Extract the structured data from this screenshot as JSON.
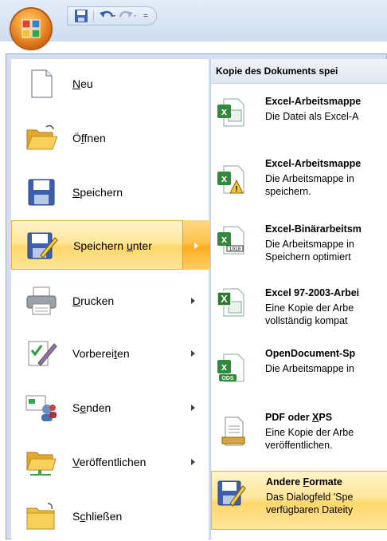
{
  "qat": {
    "save_icon": "save-icon",
    "undo_icon": "undo-icon",
    "redo_icon": "redo-icon",
    "customize_glyph": "="
  },
  "left_menu": [
    {
      "label": "Neu",
      "icon": "new-document-icon",
      "submenu": false,
      "accel": "N"
    },
    {
      "label": "Öffnen",
      "icon": "open-folder-icon",
      "submenu": false,
      "accel": "f"
    },
    {
      "label": "Speichern",
      "icon": "save-icon",
      "submenu": false,
      "accel": "S"
    },
    {
      "label": "Speichern unter",
      "icon": "save-as-icon",
      "submenu": true,
      "selected": true,
      "accel": "u"
    },
    {
      "label": "Drucken",
      "icon": "printer-icon",
      "submenu": true,
      "accel": "D"
    },
    {
      "label": "Vorbereiten",
      "icon": "prepare-icon",
      "submenu": true,
      "accel": "t"
    },
    {
      "label": "Senden",
      "icon": "send-icon",
      "submenu": true,
      "accel": "e"
    },
    {
      "label": "Veröffentlichen",
      "icon": "publish-icon",
      "submenu": true,
      "accel": "V"
    },
    {
      "label": "Schließen",
      "icon": "close-folder-icon",
      "submenu": false,
      "accel": "c"
    }
  ],
  "right_panel": {
    "header": "Kopie des Dokuments spei",
    "items": [
      {
        "title": "Excel-Arbeitsmappe",
        "desc": "Die Datei als Excel-A",
        "icon": "excel-workbook-icon"
      },
      {
        "title": "Excel-Arbeitsmappe",
        "desc": "Die Arbeitsmappe in\nspeichern.",
        "icon": "excel-macro-workbook-icon"
      },
      {
        "title": "Excel-Binärarbeitsm",
        "desc": "Die Arbeitsmappe in\nSpeichern optimiert",
        "icon": "excel-binary-workbook-icon"
      },
      {
        "title": "Excel 97-2003-Arbei",
        "desc": "Eine Kopie der Arbe\nvollständig kompat",
        "icon": "excel-97-2003-icon"
      },
      {
        "title": "OpenDocument-Sp",
        "desc": "Die Arbeitsmappe in",
        "icon": "ods-spreadsheet-icon"
      },
      {
        "title": "PDF oder XPS",
        "desc": "Eine Kopie der Arbe\nveröffentlichen.",
        "icon": "pdf-xps-icon"
      },
      {
        "title": "Andere Formate",
        "desc": "Das Dialogfeld 'Spe\nverfügbaren Dateity",
        "icon": "other-formats-icon",
        "selected": true
      }
    ]
  },
  "colors": {
    "highlight": "#ffd76b",
    "excel_green": "#2e8b3a",
    "title_bar": "#dbe6f5"
  }
}
